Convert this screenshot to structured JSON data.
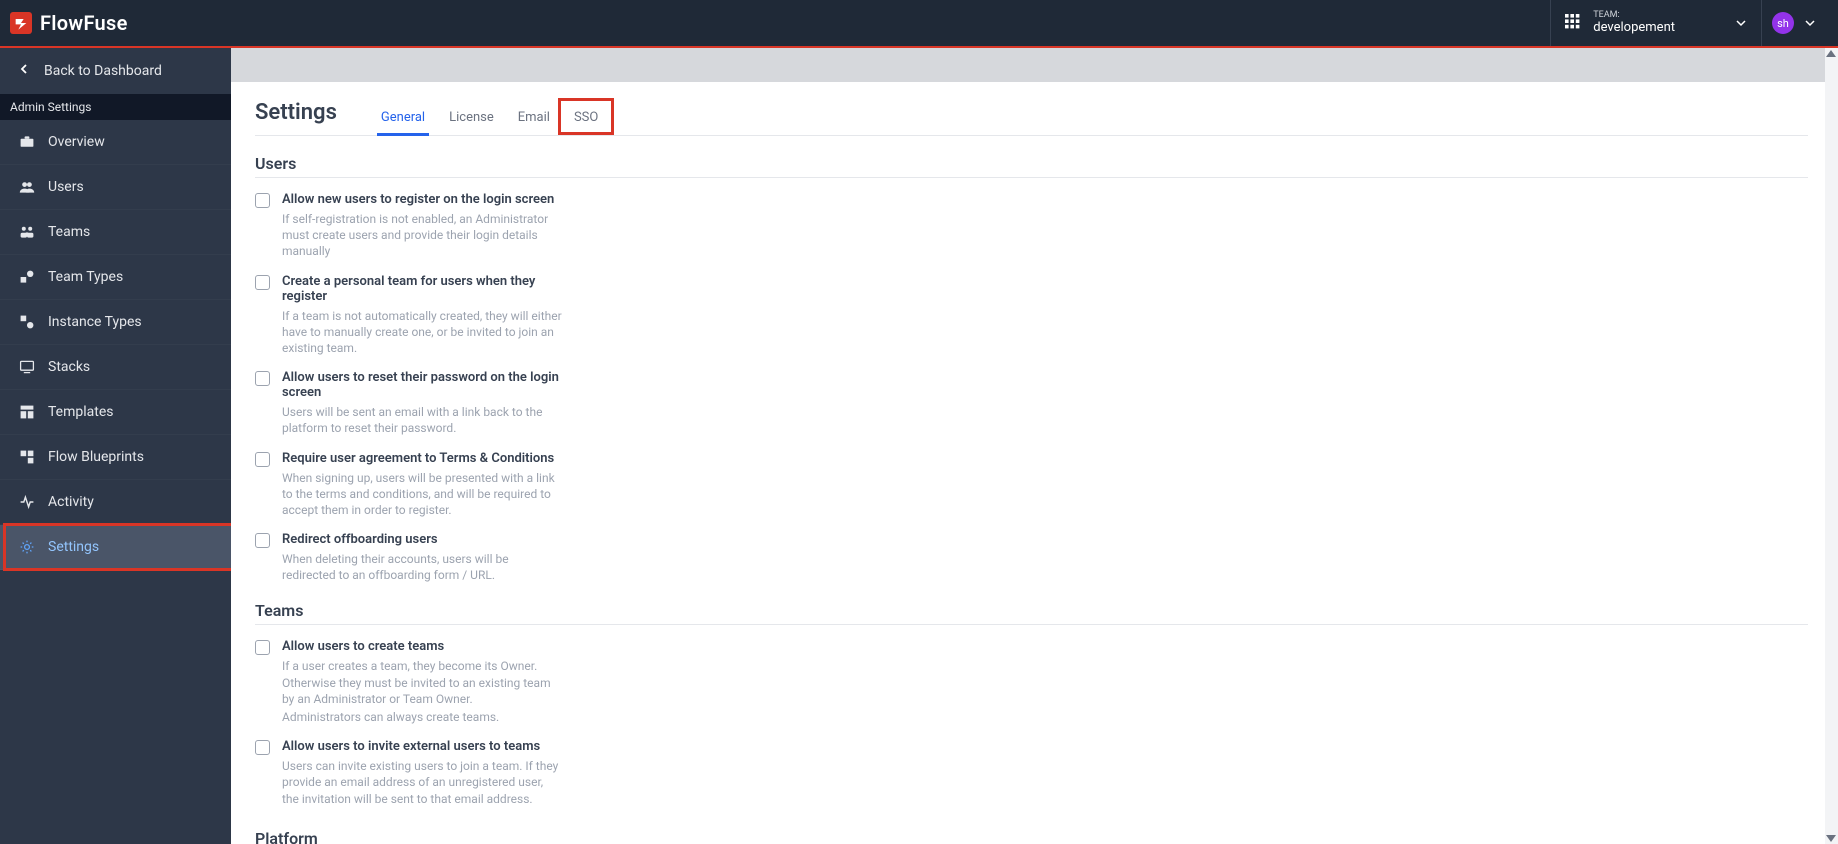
{
  "header": {
    "logo_text": "FlowFuse",
    "team_label": "TEAM:",
    "team_name": "developement",
    "avatar_initials": "sh"
  },
  "sidebar": {
    "back_label": "Back to Dashboard",
    "section_title": "Admin Settings",
    "items": [
      {
        "label": "Overview"
      },
      {
        "label": "Users"
      },
      {
        "label": "Teams"
      },
      {
        "label": "Team Types"
      },
      {
        "label": "Instance Types"
      },
      {
        "label": "Stacks"
      },
      {
        "label": "Templates"
      },
      {
        "label": "Flow Blueprints"
      },
      {
        "label": "Activity"
      },
      {
        "label": "Settings"
      }
    ]
  },
  "page": {
    "title": "Settings",
    "tabs": [
      {
        "label": "General"
      },
      {
        "label": "License"
      },
      {
        "label": "Email"
      },
      {
        "label": "SSO"
      }
    ],
    "sections": {
      "users": {
        "title": "Users",
        "options": [
          {
            "title": "Allow new users to register on the login screen",
            "desc": "If self-registration is not enabled, an Administrator must create users and provide their login details manually"
          },
          {
            "title": "Create a personal team for users when they register",
            "desc": "If a team is not automatically created, they will either have to manually create one, or be invited to join an existing team."
          },
          {
            "title": "Allow users to reset their password on the login screen",
            "desc": "Users will be sent an email with a link back to the platform to reset their password."
          },
          {
            "title": "Require user agreement to Terms & Conditions",
            "desc": "When signing up, users will be presented with a link to the terms and conditions, and will be required to accept them in order to register."
          },
          {
            "title": "Redirect offboarding users",
            "desc": "When deleting their accounts, users will be redirected to an offboarding form / URL."
          }
        ]
      },
      "teams": {
        "title": "Teams",
        "options": [
          {
            "title": "Allow users to create teams",
            "desc": "If a user creates a team, they become its Owner. Otherwise they must be invited to an existing team by an Administrator or Team Owner.",
            "desc2": "Administrators can always create teams."
          },
          {
            "title": "Allow users to invite external users to teams",
            "desc": "Users can invite existing users to join a team. If they provide an email address of an unregistered user, the invitation will be sent to that email address."
          }
        ]
      },
      "platform": {
        "title": "Platform"
      }
    }
  }
}
